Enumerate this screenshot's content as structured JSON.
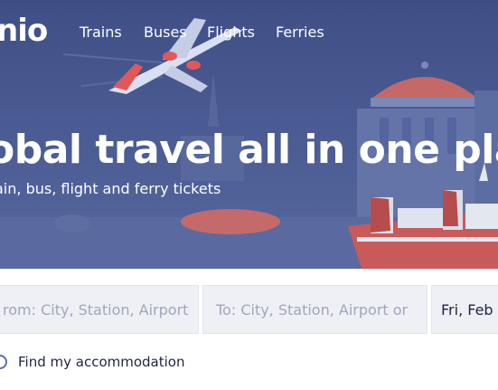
{
  "brand": {
    "logo_text": "nio"
  },
  "nav": {
    "items": [
      "Trains",
      "Buses",
      "Flights",
      "Ferries"
    ]
  },
  "hero": {
    "headline": "obal travel all in one plac",
    "subheadline": "ain, bus, flight and ferry tickets"
  },
  "search": {
    "from_placeholder": "rom: City, Station, Airport",
    "to_placeholder": "To: City, Station, Airport or",
    "date_value": "Fri, Feb"
  },
  "accommodation": {
    "label": "Find my accommodation",
    "checked": false
  },
  "colors": {
    "hero_bg": "#4a5a92",
    "field_bg": "#eef0f6",
    "ship_red": "#c85a5a"
  }
}
